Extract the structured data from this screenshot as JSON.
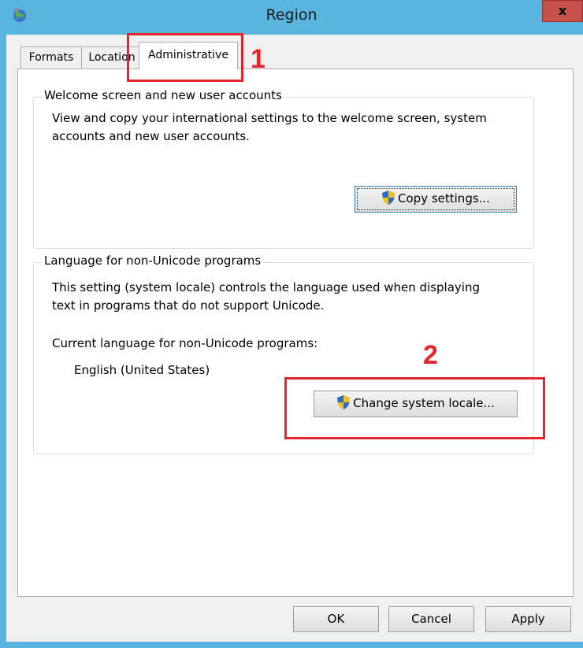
{
  "window": {
    "title": "Region",
    "close_label": "x",
    "icon": "globe-icon"
  },
  "tabs": [
    {
      "label": "Formats",
      "selected": false
    },
    {
      "label": "Location",
      "selected": false
    },
    {
      "label": "Administrative",
      "selected": true
    }
  ],
  "welcome_group": {
    "title": "Welcome screen and new user accounts",
    "desc_line1": "View and copy your international settings to the welcome screen, system",
    "desc_line2": "accounts and new user accounts.",
    "button_label": "Copy settings...",
    "button_icon": "uac-shield-icon"
  },
  "locale_group": {
    "title": "Language for non-Unicode programs",
    "desc_line1": "This setting (system locale) controls the language used when displaying",
    "desc_line2": "text in programs that do not support Unicode.",
    "current_label": "Current language for non-Unicode programs:",
    "current_value": "English (United States)",
    "button_label": "Change system locale...",
    "button_icon": "uac-shield-icon"
  },
  "footer": {
    "ok_label": "OK",
    "cancel_label": "Cancel",
    "apply_label": "Apply"
  },
  "annotations": [
    {
      "label": "1",
      "color": "#e3262d"
    },
    {
      "label": "2",
      "color": "#e3262d"
    }
  ],
  "colors": {
    "accent": "#5ab4e0",
    "close_button": "#c7504a",
    "annotation": "#e3262d"
  }
}
